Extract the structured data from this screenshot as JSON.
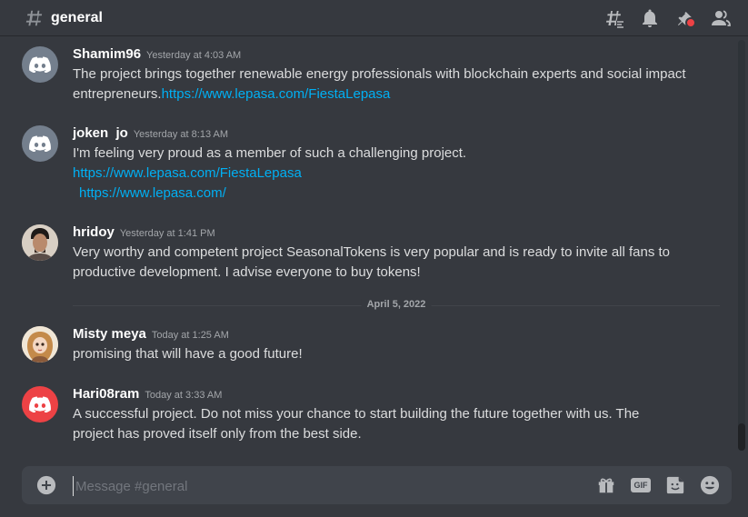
{
  "channel": {
    "name": "general"
  },
  "header_icons": [
    "threads-icon",
    "bell-icon",
    "pin-icon",
    "members-icon"
  ],
  "messages": [
    {
      "username": "Shamim96",
      "timestamp": "Yesterday at 4:03 AM",
      "avatar": "discord-default-gray",
      "text_line1": "The project brings together renewable energy professionals with blockchain experts and social impact",
      "text_line2": "entrepreneurs.",
      "link1": "https://www.lepasa.com/FiestaLepasa"
    },
    {
      "username": "joken  jo",
      "timestamp": "Yesterday at 8:13 AM",
      "avatar": "discord-default-gray",
      "text_line1": "I'm feeling very proud as a member of such a challenging project.",
      "link1": "https://www.lepasa.com/FiestaLepasa",
      "link2": "https://www.lepasa.com/"
    },
    {
      "username": "hridoy",
      "timestamp": "Yesterday at 1:41 PM",
      "avatar": "photo-man",
      "text_line1": "Very worthy and competent project SeasonalTokens is very popular and is ready to invite all fans to",
      "text_line2": "productive development. I advise everyone to buy tokens!"
    },
    {
      "username": "Misty meya",
      "timestamp": "Today at 1:25 AM",
      "avatar": "photo-doll",
      "text_line1": "promising that will have a good future!"
    },
    {
      "username": "Hari08ram",
      "timestamp": "Today at 3:33 AM",
      "avatar": "discord-default-red",
      "text_line1": "A successful project. Do not miss your chance to start building the future together with us. The",
      "text_line2": "project has proved itself only from the best side."
    }
  ],
  "date_divider": "April 5, 2022",
  "composer": {
    "placeholder": "Message #general",
    "value": "",
    "gif_label": "GIF"
  },
  "colors": {
    "background": "#36393f",
    "link": "#00b0f4",
    "composer": "#40444b",
    "red_avatar": "#ed4245",
    "gray_avatar": "#747f8d"
  }
}
